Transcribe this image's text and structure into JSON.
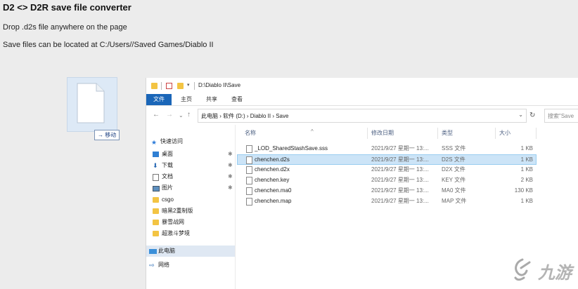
{
  "page": {
    "title": "D2 <> D2R save file converter",
    "instruction": "Drop .d2s file anywhere on the page",
    "location_note": "Save files can be located at C:/Users//Saved Games/Diablo II"
  },
  "drag": {
    "tooltip": "→ 移动"
  },
  "explorer": {
    "title_path": "D:\\Diablo II\\Save",
    "ribbon_tabs": [
      "文件",
      "主页",
      "共享",
      "查看"
    ],
    "breadcrumbs": "此电脑  ›  软件 (D:)  ›  Diablo II  ›  Save",
    "search_placeholder": "搜索\"Save",
    "nav_items": [
      {
        "label": "快速访问",
        "icon": "star-icon"
      },
      {
        "label": "桌面",
        "icon": "desktop-icon",
        "pinned": true
      },
      {
        "label": "下载",
        "icon": "download-icon",
        "pinned": true
      },
      {
        "label": "文档",
        "icon": "document-icon",
        "pinned": true
      },
      {
        "label": "图片",
        "icon": "pictures-icon",
        "pinned": true
      },
      {
        "label": "csgo",
        "icon": "folder-icon"
      },
      {
        "label": "暗黑2重制版",
        "icon": "folder-icon"
      },
      {
        "label": "暴雪战网",
        "icon": "folder-icon"
      },
      {
        "label": "超激斗梦境",
        "icon": "folder-icon"
      },
      {
        "label": "此电脑",
        "icon": "pc-icon"
      },
      {
        "label": "网络",
        "icon": "network-icon"
      }
    ],
    "columns": [
      "名称",
      "修改日期",
      "类型",
      "大小"
    ],
    "files": [
      {
        "name": "_LOD_SharedStashSave.sss",
        "date": "2021/9/27 星期一 13:...",
        "type": "SSS 文件",
        "size": "1 KB"
      },
      {
        "name": "chenchen.d2s",
        "date": "2021/9/27 星期一 13:...",
        "type": "D2S 文件",
        "size": "1 KB",
        "selected": true
      },
      {
        "name": "chenchen.d2x",
        "date": "2021/9/27 星期一 13:...",
        "type": "D2X 文件",
        "size": "1 KB"
      },
      {
        "name": "chenchen.key",
        "date": "2021/9/27 星期一 13:...",
        "type": "KEY 文件",
        "size": "2 KB"
      },
      {
        "name": "chenchen.ma0",
        "date": "2021/9/27 星期一 13:...",
        "type": "MA0 文件",
        "size": "130 KB"
      },
      {
        "name": "chenchen.map",
        "date": "2021/9/27 星期一 13:...",
        "type": "MAP 文件",
        "size": "1 KB"
      }
    ]
  },
  "watermark": {
    "text": "九游",
    "logo": "jiuyou-logo"
  }
}
